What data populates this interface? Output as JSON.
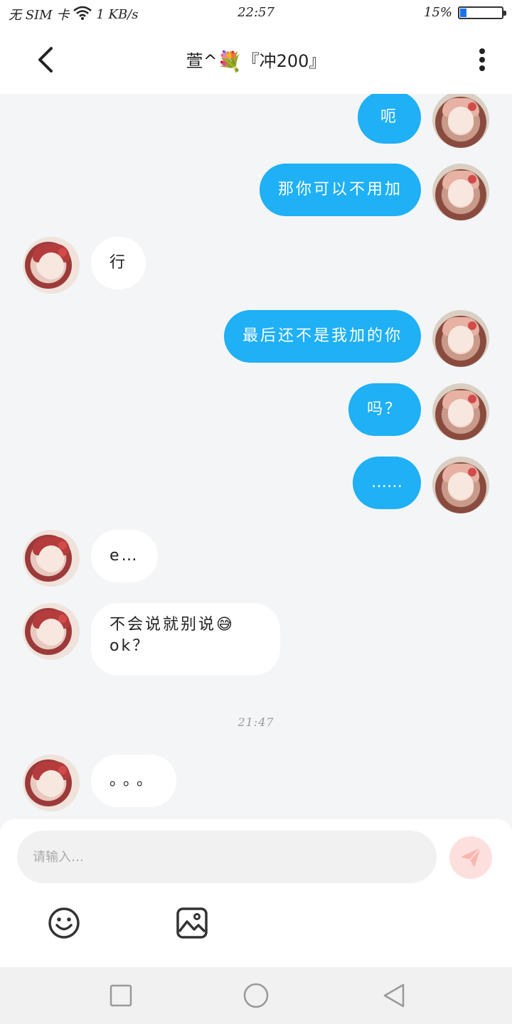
{
  "status_bar": {
    "carrier": "无 SIM 卡",
    "speed": "1 KB/s",
    "time": "22:57",
    "battery_percent": "15%",
    "battery_level": 0.15
  },
  "header": {
    "title_prefix": "萱^",
    "title_suffix": "『冲200』",
    "flower_emoji": "💐"
  },
  "messages": [
    {
      "side": "me",
      "text": "呃"
    },
    {
      "side": "me",
      "text": "那你可以不用加"
    },
    {
      "side": "other",
      "text": "行"
    },
    {
      "side": "me",
      "text": "最后还不是我加的你"
    },
    {
      "side": "me",
      "text": "吗？"
    },
    {
      "side": "me",
      "text": "……"
    },
    {
      "side": "other",
      "text": "e…"
    },
    {
      "side": "other",
      "text": "不会说就别说😅\nok？"
    },
    {
      "side": "other",
      "text": "。。。"
    }
  ],
  "timestamp": "21:47",
  "composer": {
    "placeholder": "请输入…"
  },
  "icons": {
    "back": "chevron-left-icon",
    "more": "more-vertical-icon",
    "send": "paper-plane-icon",
    "emoji": "smiley-icon",
    "image": "image-icon"
  },
  "colors": {
    "my_bubble": "#1fb0f5",
    "other_bubble": "#ffffff",
    "background": "#f4f5f7",
    "send_button": "#fde0de"
  }
}
